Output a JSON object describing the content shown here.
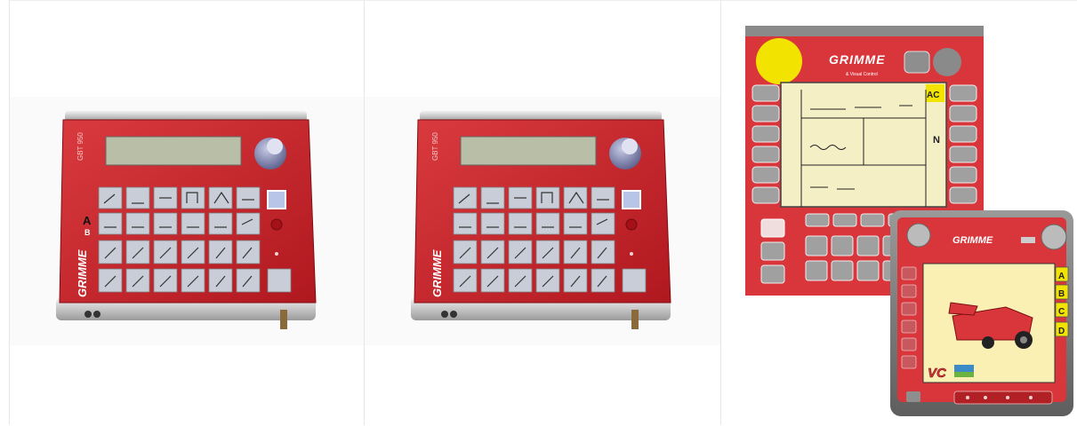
{
  "gallery": {
    "items": [
      {
        "label": "GBT 950 terminal",
        "side_text": "GBT 950",
        "brand": "GRIMME",
        "row_letter_a": "A",
        "row_letter_b": "A",
        "row_letter_c": "B"
      },
      {
        "label": "GBT 950 terminal",
        "side_text": "GBT 950",
        "brand": "GRIMME"
      },
      {
        "label": "Visual Control terminals",
        "brand": "GRIMME",
        "subbrand": "& Visual Control",
        "brand2": "GRIMME",
        "letters": [
          "A",
          "B",
          "C",
          "D"
        ],
        "vc": "VC",
        "corner_letters": "AC",
        "n_icon": "N"
      }
    ]
  },
  "colors": {
    "red": "#c8242c",
    "dark_red": "#8e1418",
    "lcd": "#b9bfa7",
    "yellow": "#f2e300",
    "metal": "#d9d9d9"
  }
}
